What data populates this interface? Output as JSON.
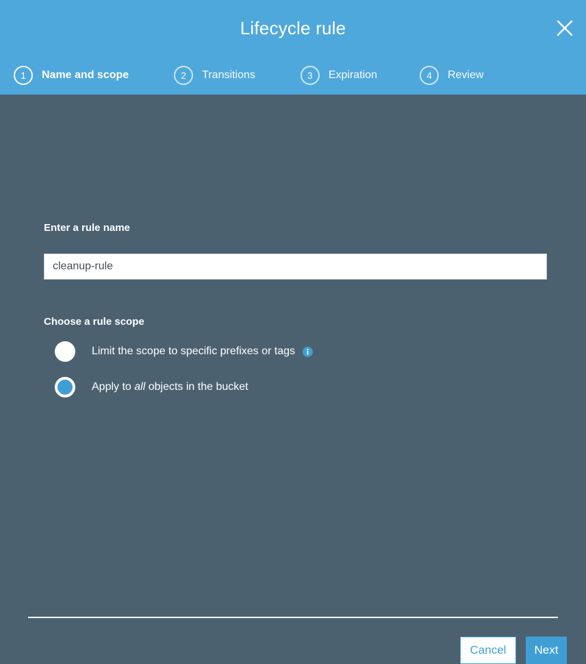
{
  "colors": {
    "header_blue": "#4fa8dc",
    "body_slate": "#4c6170",
    "accent_blue": "#3f9fd4",
    "white": "#ffffff"
  },
  "header": {
    "title": "Lifecycle rule",
    "close_icon": "close-icon",
    "steps": [
      {
        "number": "1",
        "label": "Name and scope",
        "active": true
      },
      {
        "number": "2",
        "label": "Transitions",
        "active": false
      },
      {
        "number": "3",
        "label": "Expiration",
        "active": false
      },
      {
        "number": "4",
        "label": "Review",
        "active": false
      }
    ]
  },
  "form": {
    "rule_name_label": "Enter a rule name",
    "rule_name_value": "cleanup-rule",
    "rule_name_placeholder": "Enter a rule name",
    "rule_scope_label": "Choose a rule scope",
    "scope_options": [
      {
        "label_prefix": "Limit the scope to specific prefixes or tags",
        "label_emphasis": "",
        "label_suffix": "",
        "selected": false,
        "has_info_icon": true,
        "info_icon": "info-icon"
      },
      {
        "label_prefix": "Apply to ",
        "label_emphasis": "all",
        "label_suffix": " objects in the bucket",
        "selected": true,
        "has_info_icon": false,
        "info_icon": ""
      }
    ]
  },
  "footer": {
    "cancel_label": "Cancel",
    "next_label": "Next"
  }
}
